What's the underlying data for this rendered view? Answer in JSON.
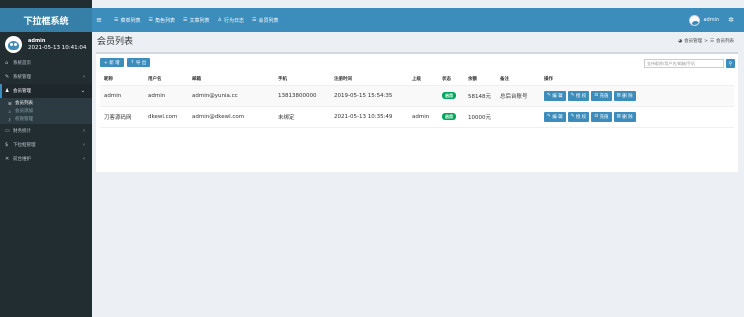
{
  "header": {
    "logo": "下拉框系统",
    "toggle_icon": "menu-icon",
    "nav": [
      {
        "label": "菜单列表",
        "icon": "list-icon"
      },
      {
        "label": "角色列表",
        "icon": "list-icon"
      },
      {
        "label": "文章列表",
        "icon": "list-icon"
      },
      {
        "label": "行为日志",
        "icon": "person-icon"
      },
      {
        "label": "会员列表",
        "icon": "list-icon"
      }
    ],
    "user": "admin"
  },
  "sidebar": {
    "user_name": "admin",
    "user_time": "2021-05-13 10:41:04",
    "menu": [
      {
        "label": "系统首页",
        "icon": "home-icon"
      },
      {
        "label": "系统管理",
        "icon": "wrench-icon"
      },
      {
        "label": "会员管理",
        "icon": "users-icon"
      },
      {
        "label": "财务统计",
        "icon": "monitor-icon"
      },
      {
        "label": "下拉框管理",
        "icon": "dollar-icon"
      },
      {
        "label": "前台维护",
        "icon": "tools-icon"
      }
    ],
    "submenu": [
      {
        "label": "会员列表",
        "icon": "list-icon"
      },
      {
        "label": "会员添加",
        "icon": "user-add-icon"
      },
      {
        "label": "权限管理",
        "icon": "key-icon"
      }
    ]
  },
  "content": {
    "title": "会员列表",
    "breadcrumb": [
      "会员管理",
      ">",
      "会员列表"
    ],
    "toolbar": {
      "add": "+ 新 增",
      "export": "导 出"
    },
    "search_placeholder": "支持昵称/用户名/邮箱/手机",
    "table": {
      "headers": [
        "昵称",
        "用户名",
        "邮箱",
        "手机",
        "注册时间",
        "上级",
        "状态",
        "余额",
        "备注",
        "操作"
      ],
      "rows": [
        {
          "nick": "admin",
          "username": "admin",
          "email": "admin@yunia.cc",
          "phone": "13813800000",
          "reg": "2019-05-15 15:54:35",
          "parent": "",
          "status": "启用",
          "balance": "58148元",
          "remark": "总后台账号"
        },
        {
          "nick": "刀客源码网",
          "username": "dkewl.com",
          "email": "admin@dkewl.com",
          "phone": "未绑定",
          "reg": "2021-05-13 10:35:49",
          "parent": "admin",
          "status": "启用",
          "balance": "10000元",
          "remark": ""
        }
      ],
      "ops": [
        "编 辑",
        "授 权",
        "充值",
        "删 除"
      ]
    }
  },
  "colors": {
    "brand": "#3c8dbc",
    "sidebar": "#222d32",
    "logo": "#367fa9",
    "success": "#00a65a"
  }
}
